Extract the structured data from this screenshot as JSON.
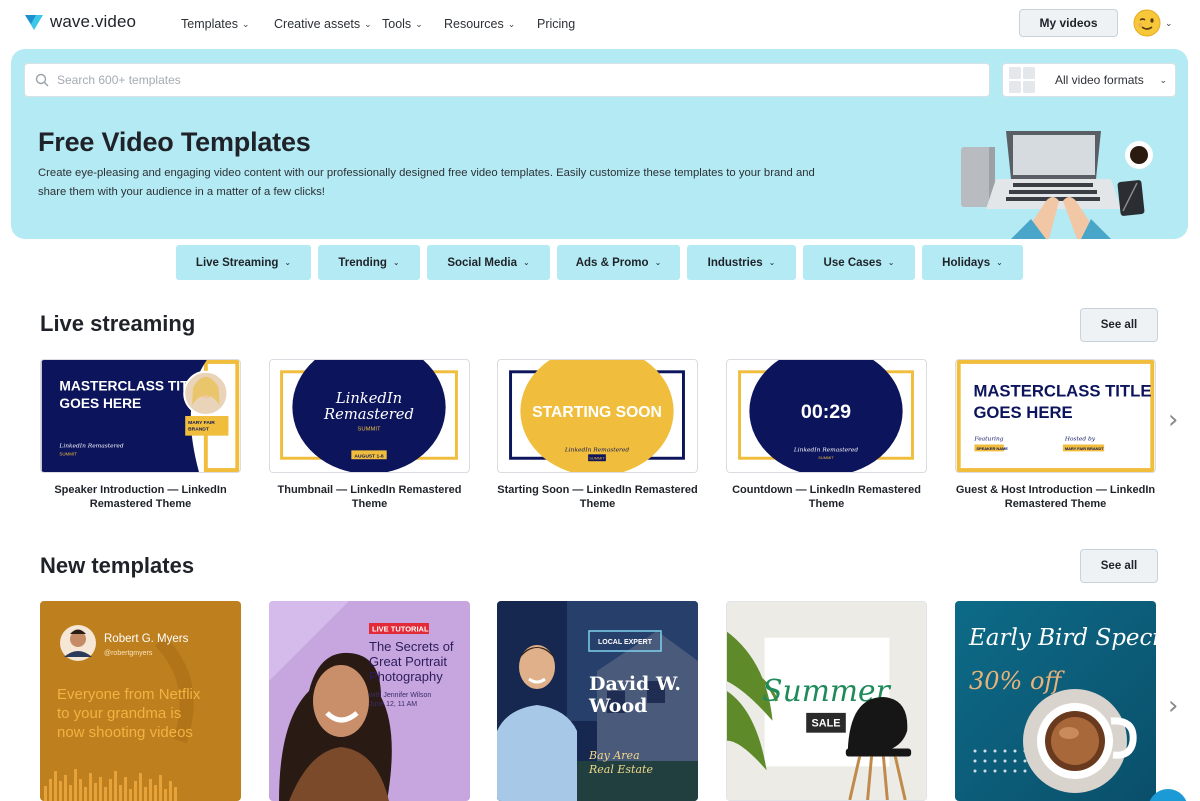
{
  "app": {
    "logo_text": "wave.video"
  },
  "nav": {
    "items": [
      {
        "label": "Templates",
        "chevron": true
      },
      {
        "label": "Creative assets",
        "chevron": true
      },
      {
        "label": "Tools",
        "chevron": true
      },
      {
        "label": "Resources",
        "chevron": true
      },
      {
        "label": "Pricing",
        "chevron": false
      }
    ],
    "my_videos_label": "My videos",
    "avatar_icon": "winking-face-emoji-icon"
  },
  "hero": {
    "search_placeholder": "Search 600+ templates",
    "format_label": "All video formats",
    "title": "Free Video Templates",
    "description": "Create eye-pleasing and engaging video content with our professionally designed free video templates. Easily customize these templates to your brand and share them with your audience in a matter of a few clicks!",
    "background_color": "#b3eaf3"
  },
  "categories": [
    "Live Streaming",
    "Trending",
    "Social Media",
    "Ads & Promo",
    "Industries",
    "Use Cases",
    "Holidays"
  ],
  "live_streaming": {
    "title": "Live streaming",
    "see_all": "See all",
    "cards": [
      {
        "caption": "Speaker Introduction — LinkedIn Remastered Theme",
        "thumb": {
          "headline_1": "MASTERCLASS TITLE",
          "headline_2": "GOES HERE",
          "name_tag_1": "MARY FAIR",
          "name_tag_2": "BRANDT",
          "script_text": "LinkedIn Remastered",
          "small_text": "SUMMIT"
        }
      },
      {
        "caption": "Thumbnail — LinkedIn Remastered Theme",
        "thumb": {
          "script_1": "LinkedIn",
          "script_2": "Remastered",
          "small_text": "SUMMIT",
          "date_tag": "AUGUST 1-6"
        }
      },
      {
        "caption": "Starting Soon — LinkedIn Remastered Theme",
        "thumb": {
          "headline": "STARTING SOON",
          "script_text": "LinkedIn Remastered",
          "small_text": "SUMMIT"
        }
      },
      {
        "caption": "Countdown — LinkedIn Remastered Theme",
        "thumb": {
          "timer": "00:29",
          "script_text": "LinkedIn Remastered",
          "small_text": "SUMMIT"
        }
      },
      {
        "caption": "Guest & Host Introduction — LinkedIn Remastered Theme",
        "thumb": {
          "headline_1": "MASTERCLASS TITLE",
          "headline_2": "GOES HERE",
          "featuring": "Featuring",
          "hosted_by": "Hosted by",
          "speaker_tag": "SPEAKER NAME",
          "host_tag": "MARY FAIR BRANDT"
        }
      }
    ]
  },
  "new_templates": {
    "title": "New templates",
    "see_all": "See all",
    "cards": [
      {
        "name": "Robert G. Myers",
        "handle": "@robertgmyers",
        "text": "Everyone from Netflix to your grandma is now shooting videos"
      },
      {
        "badge": "LIVE TUTORIAL",
        "title": "The Secrets of Great Portrait Photography",
        "with": "with Jennifer Wilson",
        "date": "June 12, 11 AM"
      },
      {
        "badge": "LOCAL EXPERT",
        "name_1": "David W.",
        "name_2": "Wood",
        "sub_1": "Bay Area",
        "sub_2": "Real Estate"
      },
      {
        "script": "Summer",
        "badge": "SALE"
      },
      {
        "script": "Early Bird Special",
        "offer": "30% off"
      }
    ]
  },
  "colors": {
    "navy": "#0c145c",
    "gold": "#f0be3c",
    "hero_bg": "#b3eaf3",
    "button_bg": "#eef2f5"
  }
}
